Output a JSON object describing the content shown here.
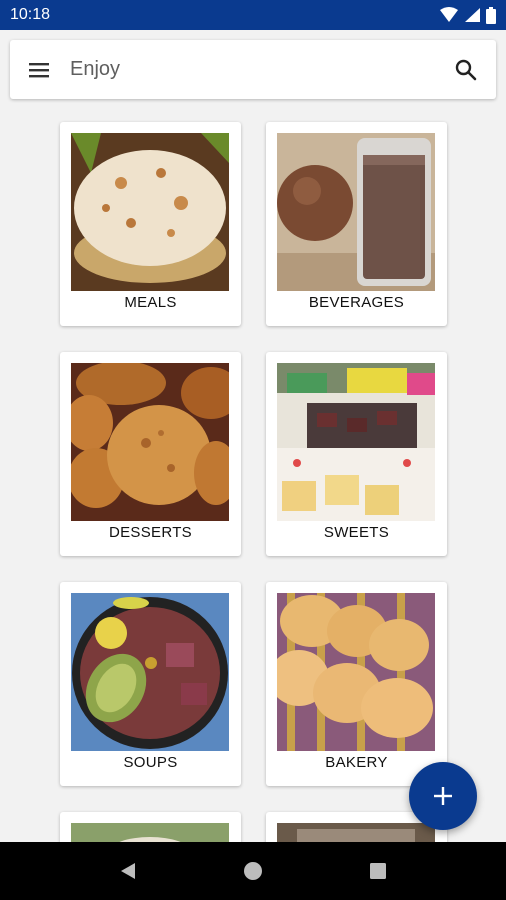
{
  "status": {
    "time": "10:18"
  },
  "app_bar": {
    "title": "Enjoy",
    "menu_icon": "menu-icon",
    "search_icon": "search-icon"
  },
  "categories": [
    {
      "label": "MEALS"
    },
    {
      "label": "BEVERAGES"
    },
    {
      "label": "DESSERTS"
    },
    {
      "label": "SWEETS"
    },
    {
      "label": "SOUPS"
    },
    {
      "label": "BAKERY"
    }
  ],
  "fab": {
    "icon": "add-icon"
  },
  "colors": {
    "primary": "#0a3a8f",
    "background": "#f2f2f2"
  }
}
